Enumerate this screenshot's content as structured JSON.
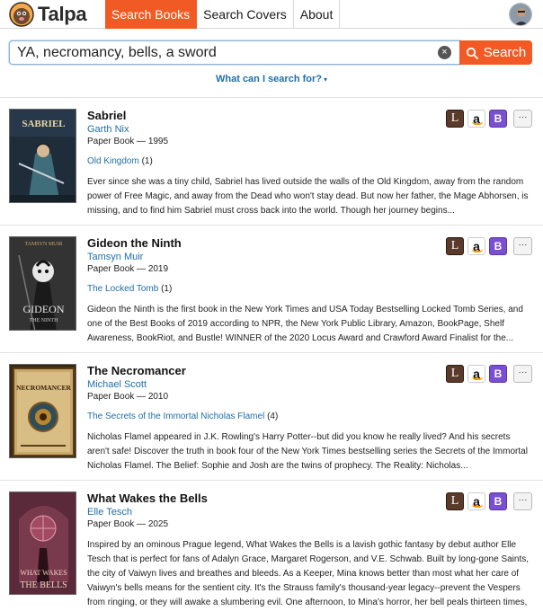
{
  "header": {
    "logo_text": "Talpa",
    "tabs": [
      {
        "label": "Search Books",
        "active": true
      },
      {
        "label": "Search Covers",
        "active": false
      },
      {
        "label": "About",
        "active": false
      }
    ]
  },
  "search": {
    "value": "YA, necromancy, bells, a sword",
    "clear_icon": "×",
    "button_label": "Search",
    "help_link": "What can I search for?",
    "help_caret": "▾"
  },
  "more_label": "···",
  "results": [
    {
      "title": "Sabriel",
      "author": "Garth Nix",
      "meta": "Paper Book — 1995",
      "series_name": "Old Kingdom",
      "series_count": "(1)",
      "description": "Ever since she was a tiny child, Sabriel has lived outside the walls of the Old Kingdom, away from the random power of Free Magic, and away from the Dead who won't stay dead. But now her father, the Mage Abhorsen, is missing, and to find him Sabriel must cross back into the world. Though her journey begins...",
      "cover_text": "SABRIEL",
      "cover_bg": "#1f2c3a"
    },
    {
      "title": "Gideon the Ninth",
      "author": "Tamsyn Muir",
      "meta": "Paper Book — 2019",
      "series_name": "The Locked Tomb",
      "series_count": "(1)",
      "description": "Gideon the Ninth is the first book in the New York Times and USA Today Bestselling Locked Tomb Series, and one of the Best Books of 2019 according to NPR, the New York Public Library, Amazon, BookPage, Shelf Awareness, BookRiot, and Bustle! WINNER of the 2020 Locus Award and Crawford Award Finalist for the...",
      "cover_text": "GIDEON",
      "cover_subtext": "THE NINTH",
      "cover_top": "TAMSYN MUIR",
      "cover_bg": "#2a2a2a"
    },
    {
      "title": "The Necromancer",
      "author": "Michael Scott",
      "meta": "Paper Book — 2010",
      "series_name": "The Secrets of the Immortal Nicholas Flamel",
      "series_count": "(4)",
      "description": "Nicholas Flamel appeared in J.K. Rowling's Harry Potter--but did you know he really lived? And his secrets aren't safe! Discover the truth in book four of the New York Times bestselling series the Secrets of the Immortal Nicholas Flamel.  The Belief: Sophie and Josh are the twins of prophecy. The Reality: Nicholas...",
      "cover_text": "NECROMANCER",
      "cover_bg": "#3a2a14"
    },
    {
      "title": "What Wakes the Bells",
      "author": "Elle Tesch",
      "meta": "Paper Book — 2025",
      "series_name": "",
      "series_count": "",
      "description": "Inspired by an ominous Prague legend, What Wakes the Bells is a lavish gothic fantasy by debut author Elle Tesch that is perfect for fans of Adalyn Grace, Margaret Rogerson, and V.E. Schwab. Built by long-gone Saints, the city of Vaiwyn lives and breathes and bleeds. As a Keeper, Mina knows better than most what her care of Vaiwyn's bells means for the sentient city. It's the Strauss family's thousand-year legacy--prevent the Vespers from ringing, or they will awake a slumbering evil. One afternoon, to Mina's horror, her bell peals thirteen times, shattering the city's tenuous peace. With so much of the city's history and lore lost in a long-",
      "cover_text": "WHAT WAKES",
      "cover_subtext": "THE BELLS",
      "cover_bg": "#5a2a3a"
    }
  ],
  "colors": {
    "accent": "#f15a24",
    "link": "#1f6fa8"
  }
}
